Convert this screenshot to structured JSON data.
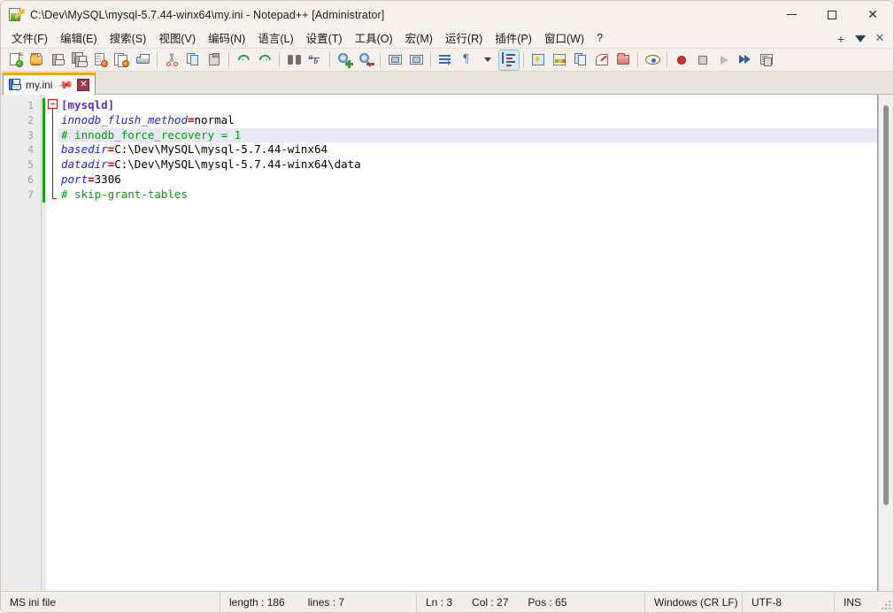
{
  "window": {
    "title": "C:\\Dev\\MySQL\\mysql-5.7.44-winx64\\my.ini - Notepad++ [Administrator]",
    "app_icon": "notepad-plus-plus-icon",
    "controls": {
      "minimize": "minimize-icon",
      "maximize": "maximize-icon",
      "close": "close-icon"
    }
  },
  "menubar": {
    "items": [
      {
        "label": "文件(F)",
        "name": "menu-file"
      },
      {
        "label": "编辑(E)",
        "name": "menu-edit"
      },
      {
        "label": "搜索(S)",
        "name": "menu-search"
      },
      {
        "label": "视图(V)",
        "name": "menu-view"
      },
      {
        "label": "编码(N)",
        "name": "menu-encoding"
      },
      {
        "label": "语言(L)",
        "name": "menu-language"
      },
      {
        "label": "设置(T)",
        "name": "menu-settings"
      },
      {
        "label": "工具(O)",
        "name": "menu-tools"
      },
      {
        "label": "宏(M)",
        "name": "menu-macro"
      },
      {
        "label": "运行(R)",
        "name": "menu-run"
      },
      {
        "label": "插件(P)",
        "name": "menu-plugins"
      },
      {
        "label": "窗口(W)",
        "name": "menu-window"
      },
      {
        "label": "?",
        "name": "menu-help"
      }
    ],
    "right_controls": [
      {
        "label": "+",
        "name": "document-add-button",
        "icon": "plus-icon"
      },
      {
        "label": "",
        "name": "document-list-button",
        "icon": "triangle-down-icon"
      },
      {
        "label": "",
        "name": "document-close-button",
        "icon": "close-x-icon"
      }
    ]
  },
  "toolbar": {
    "buttons": [
      {
        "name": "new-file-button",
        "icon": "new-document-icon"
      },
      {
        "name": "open-file-button",
        "icon": "open-folder-icon"
      },
      {
        "name": "save-button",
        "icon": "floppy-save-icon"
      },
      {
        "name": "save-all-button",
        "icon": "save-all-icon"
      },
      {
        "name": "close-file-button",
        "icon": "close-document-icon"
      },
      {
        "name": "close-all-button",
        "icon": "close-all-documents-icon"
      },
      {
        "name": "print-button",
        "icon": "printer-icon"
      },
      {
        "name": "cut-button",
        "icon": "scissors-icon"
      },
      {
        "name": "copy-button",
        "icon": "copy-pages-icon"
      },
      {
        "name": "paste-button",
        "icon": "clipboard-paste-icon"
      },
      {
        "name": "undo-button",
        "icon": "undo-arrow-icon"
      },
      {
        "name": "redo-button",
        "icon": "redo-arrow-icon"
      },
      {
        "name": "find-button",
        "icon": "binoculars-icon"
      },
      {
        "name": "replace-button",
        "icon": "replace-ab-icon"
      },
      {
        "name": "zoom-in-button",
        "icon": "magnifier-plus-icon"
      },
      {
        "name": "zoom-out-button",
        "icon": "magnifier-minus-icon"
      },
      {
        "name": "sync-vertical-button",
        "icon": "sync-scroll-vertical-icon"
      },
      {
        "name": "sync-horizontal-button",
        "icon": "sync-scroll-horizontal-icon"
      },
      {
        "name": "word-wrap-button",
        "icon": "word-wrap-icon"
      },
      {
        "name": "show-all-chars-button",
        "icon": "pilcrow-icon"
      },
      {
        "name": "show-all-chars-dropdown",
        "icon": "chevron-down-icon"
      },
      {
        "name": "indent-guide-button",
        "icon": "indent-guide-icon",
        "active": true
      },
      {
        "name": "user-defined-dialog-button",
        "icon": "udl-lightning-icon"
      },
      {
        "name": "document-map-button",
        "icon": "document-map-icon"
      },
      {
        "name": "function-list-button",
        "icon": "function-list-icon"
      },
      {
        "name": "doc-switcher-button",
        "icon": "document-switcher-icon"
      },
      {
        "name": "folder-workspace-button",
        "icon": "folder-as-workspace-icon"
      },
      {
        "name": "monitoring-button",
        "icon": "eye-monitor-icon"
      },
      {
        "name": "macro-record-button",
        "icon": "record-dot-icon"
      },
      {
        "name": "macro-stop-button",
        "icon": "stop-square-icon"
      },
      {
        "name": "macro-play-button",
        "icon": "play-triangle-icon"
      },
      {
        "name": "macro-run-multiple-button",
        "icon": "fast-forward-icon"
      },
      {
        "name": "macro-save-button",
        "icon": "save-macro-panel-icon"
      }
    ]
  },
  "tabs": [
    {
      "label": "my.ini",
      "name": "tab-my-ini",
      "active": true,
      "icon": "blue-floppy-icon",
      "pin_icon": "pin-icon",
      "close_icon": "tab-close-icon"
    }
  ],
  "editor": {
    "line_numbers": [
      "1",
      "2",
      "3",
      "4",
      "5",
      "6",
      "7"
    ],
    "current_line": 3,
    "lines": [
      {
        "n": 1,
        "type": "section",
        "text": "[mysqld]"
      },
      {
        "n": 2,
        "type": "kv",
        "key": "innodb_flush_method",
        "eq": "=",
        "value": "normal"
      },
      {
        "n": 3,
        "type": "comment",
        "text": "# innodb_force_recovery = 1"
      },
      {
        "n": 4,
        "type": "kv",
        "key": "basedir",
        "eq": "=",
        "value": "C:\\Dev\\MySQL\\mysql-5.7.44-winx64"
      },
      {
        "n": 5,
        "type": "kv",
        "key": "datadir",
        "eq": "=",
        "value": "C:\\Dev\\MySQL\\mysql-5.7.44-winx64\\data"
      },
      {
        "n": 6,
        "type": "kv",
        "key": "port",
        "eq": "=",
        "value": "3306"
      },
      {
        "n": 7,
        "type": "comment",
        "text": "# skip-grant-tables"
      }
    ],
    "fold_marker": "collapse-minus-icon",
    "scrollbar": {
      "name": "editor-vertical-scrollbar",
      "thumb": "scroll-thumb"
    }
  },
  "statusbar": {
    "file_type": "MS ini file",
    "length_label": "length : 186",
    "lines_label": "lines : 7",
    "ln": "Ln : 3",
    "col": "Col : 27",
    "pos": "Pos : 65",
    "eol": "Windows (CR LF)",
    "encoding": "UTF-8",
    "insert_mode": "INS"
  },
  "colors": {
    "accent_tab": "#f0a30a",
    "section": "#5b2bcf",
    "key": "#2222dd",
    "equals": "#cc0000",
    "comment": "#00a000",
    "change_marker": "#18a018",
    "current_line_bg": "#e8e8f8",
    "fold_marker": "#d01010"
  }
}
